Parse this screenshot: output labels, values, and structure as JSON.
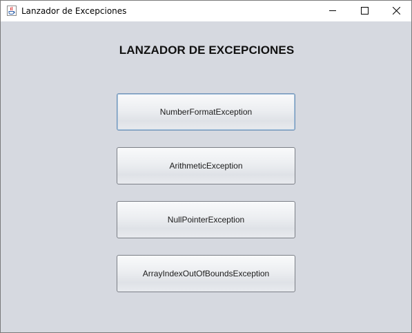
{
  "window": {
    "title": "Lanzador de Excepciones",
    "controls": {
      "minimize_icon": "minimize-icon",
      "maximize_icon": "maximize-icon",
      "close_icon": "close-icon"
    }
  },
  "main": {
    "heading": "LANZADOR DE EXCEPCIONES",
    "buttons": [
      {
        "label": "NumberFormatException",
        "focused": true
      },
      {
        "label": "ArithmeticException",
        "focused": false
      },
      {
        "label": "NullPointerException",
        "focused": false
      },
      {
        "label": "ArrayIndexOutOfBoundsException",
        "focused": false
      }
    ]
  },
  "colors": {
    "background": "#d6d9e0",
    "titlebar": "#ffffff",
    "button_border": "#7b7f86",
    "focus_border": "#6f93b8"
  }
}
